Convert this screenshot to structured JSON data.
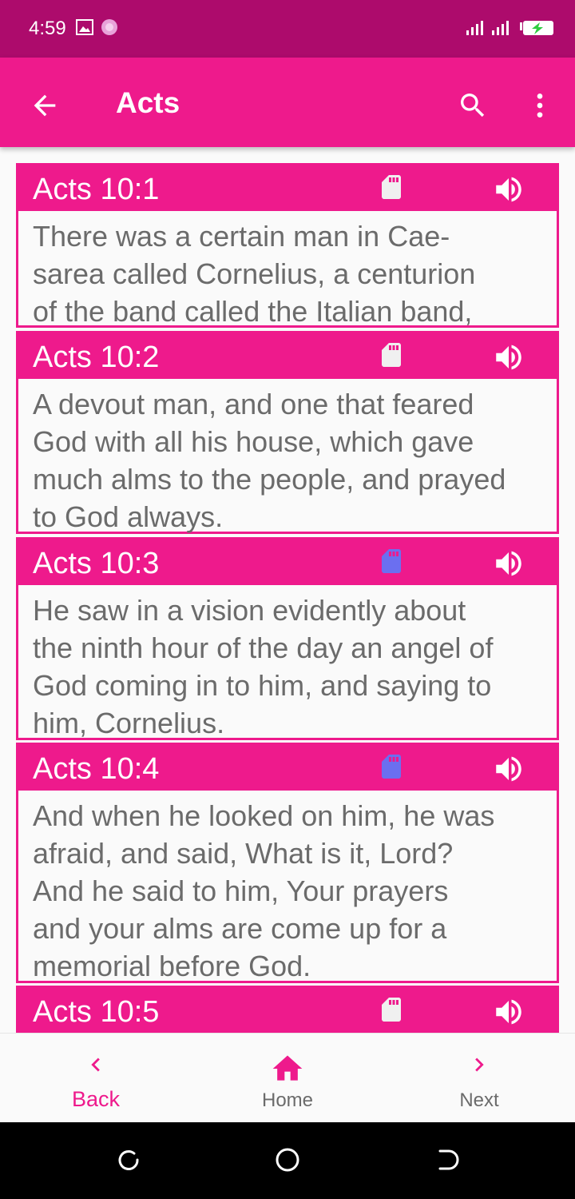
{
  "status": {
    "time": "4:59",
    "icons": [
      "image-icon",
      "flower-icon",
      "signal-icon",
      "signal-icon",
      "battery-charging-icon"
    ]
  },
  "appbar": {
    "title": "Acts",
    "icons": [
      "back-arrow-icon",
      "search-icon",
      "more-vert-icon"
    ]
  },
  "verses": [
    {
      "ref": "Acts 10:1",
      "text": "There was a certain man in Cae-\nsarea called Cornelius, a centurion\nof the band called the Italian band,",
      "card_icon": "sd-card-icon",
      "card_color": "#f0f0f0",
      "audio_icon": "volume-icon"
    },
    {
      "ref": "Acts 10:2",
      "text": "A devout man, and one that feared\nGod with all his house, which gave\nmuch alms to the people, and prayed\nto God always.",
      "card_icon": "sd-card-icon",
      "card_color": "#f0f0f0",
      "audio_icon": "volume-icon"
    },
    {
      "ref": "Acts 10:3",
      "text": "He saw in a vision evidently about\nthe ninth hour of the day an angel of\nGod coming in to him, and saying to\nhim, Cornelius.",
      "card_icon": "sd-card-icon",
      "card_color": "#6b6ff0",
      "audio_icon": "volume-icon"
    },
    {
      "ref": "Acts 10:4",
      "text": "And when he looked on him, he was\nafraid, and said, What is it, Lord?\nAnd he said to him, Your prayers\nand your alms are come up for a\nmemorial before God.",
      "card_icon": "sd-card-icon",
      "card_color": "#6b6ff0",
      "audio_icon": "volume-icon"
    },
    {
      "ref": "Acts 10:5",
      "text": "",
      "card_icon": "sd-card-icon",
      "card_color": "#f0f0f0",
      "audio_icon": "volume-icon"
    }
  ],
  "bottom_nav": {
    "back": "Back",
    "home": "Home",
    "next": "Next"
  },
  "colors": {
    "accent": "#ee1a8c",
    "status_bar": "#ad0b6c",
    "bookmarked": "#6b6ff0"
  }
}
